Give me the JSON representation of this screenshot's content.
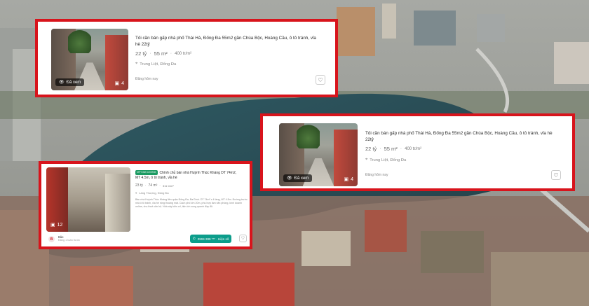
{
  "listing_a": {
    "title": "Tôi cần bán gấp nhà phố Thái Hà, Đống Đa 55m2 gần Chùa Bộc, Hoàng Cầu, ô tô tránh, vỉa hè 22tỷ",
    "price": "22 tỷ",
    "area": "55 m²",
    "price_per_m2": "400 tr/m²",
    "location": "Trung Liệt, Đống Đa",
    "posted": "Đăng hôm nay",
    "seen_label": "Đã xem",
    "image_count": "4"
  },
  "listing_b": {
    "title": "Tôi cần bán gấp nhà phố Thái Hà, Đống Đa 55m2 gần Chùa Bộc, Hoàng Cầu, ô tô tránh, vỉa hè 22tỷ",
    "price": "22 tỷ",
    "area": "55 m²",
    "price_per_m2": "400 tr/m²",
    "location": "Trung Liệt, Đống Đa",
    "posted": "Đăng hôm nay",
    "seen_label": "Đã xem",
    "image_count": "4"
  },
  "listing_c": {
    "badge": "VIP KIM CƯƠNG",
    "title": "Chính chủ bán nhà Huỳnh Thúc Kháng DT 74m2, MT 4.5m, ô tô tránh, vỉa hè",
    "price": "23 tỷ",
    "area": "74 m²",
    "price_per_m2": "311 tr/m²",
    "location": "Láng Thượng, Đống Đa",
    "description": "Bán nhà Huỳnh Thúc Kháng liên quận Đống Đa, Ba Đình. DT 74m² x 4 tầng, MT 4.5m. Đường trước nhà ô tô tránh, vỉa hè rộng thoáng mát. Cách phố lớn 20m, phù hợp làm văn phòng, kinh doanh online, cho thuê căn hộ. Nhà xây kiên cố, tiện ích xung quanh đầy đủ.",
    "image_count": "12",
    "agent_initial": "B",
    "agent_name": "Bảo",
    "agent_posted": "Đăng 1 tuần trước",
    "phone_label": "0904 289 *** · Hiện số"
  },
  "colors": {
    "frame": "#d8141c",
    "phone_button": "#0c9d8b",
    "vip_badge": "#1d9b63"
  }
}
